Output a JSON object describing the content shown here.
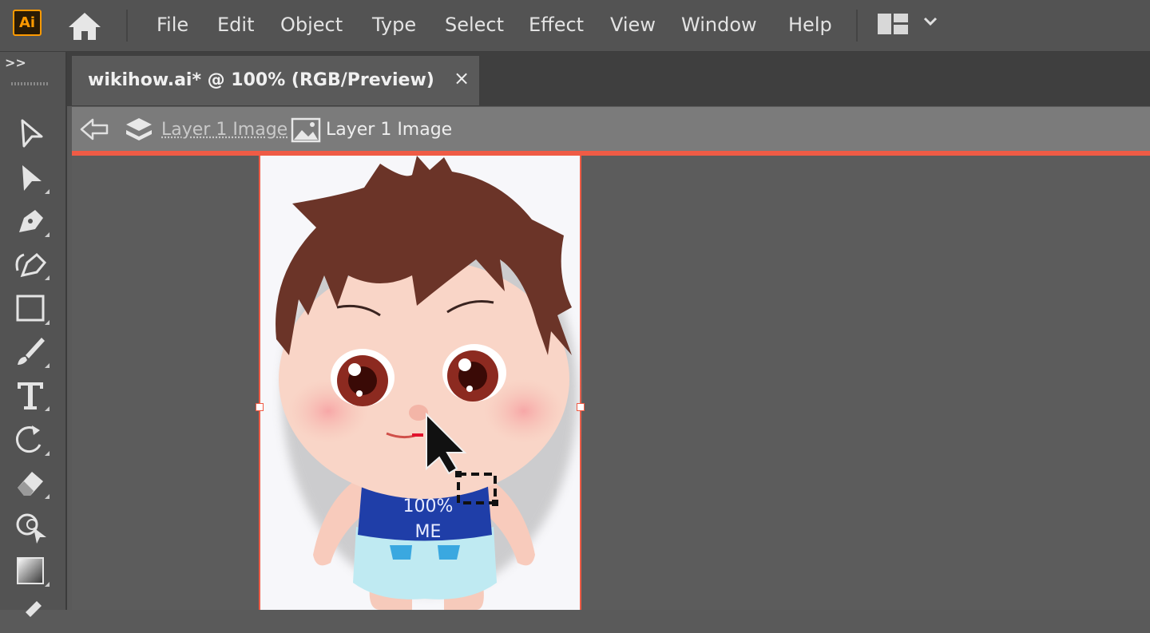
{
  "app": {
    "logo_text": "Ai",
    "accent": "#ff9a00"
  },
  "menu": [
    "File",
    "Edit",
    "Object",
    "Type",
    "Select",
    "Effect",
    "View",
    "Window",
    "Help"
  ],
  "toolbar": {
    "collapse_label": ">>",
    "tools": [
      "selection-tool",
      "direct-selection-tool",
      "pen-tool",
      "curvature-tool",
      "rectangle-tool",
      "paintbrush-tool",
      "type-tool",
      "rotate-tool",
      "eraser-tool",
      "shape-builder-tool",
      "gradient-tool"
    ]
  },
  "document": {
    "tab_title": "wikihow.ai* @ 100% (RGB/Preview)",
    "close_label": "×"
  },
  "breadcrumb": {
    "parent_label": "Layer 1 Image",
    "current_label": "Layer 1 Image",
    "highlight_color": "#ef5b45"
  },
  "artwork": {
    "shirt_text_line1": "100%",
    "shirt_text_line2": "ME"
  }
}
